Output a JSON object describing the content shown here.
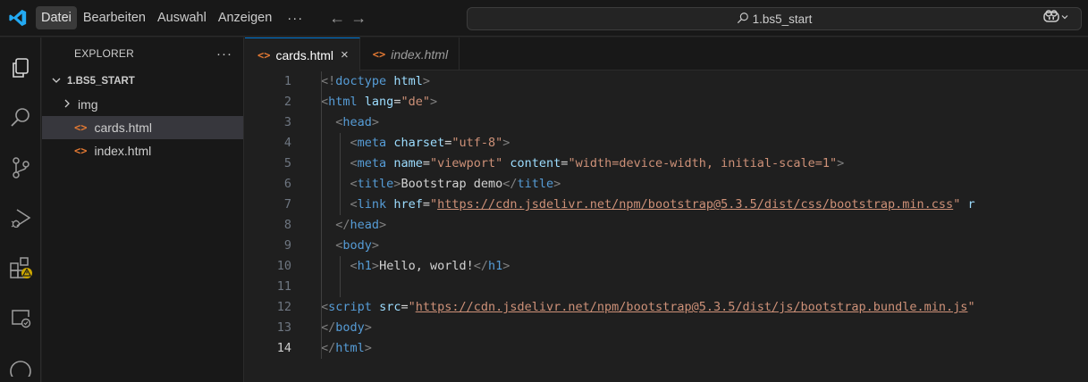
{
  "menu": {
    "items": [
      "Datei",
      "Bearbeiten",
      "Auswahl",
      "Anzeigen"
    ],
    "more": "···"
  },
  "nav": {
    "back": "←",
    "forward": "→"
  },
  "search": {
    "text": "1.bs5_start"
  },
  "sidebar": {
    "title": "EXPLORER",
    "more": "···",
    "root": "1.BS5_START",
    "items": [
      {
        "label": "img",
        "kind": "folder"
      },
      {
        "label": "cards.html",
        "kind": "file",
        "selected": true
      },
      {
        "label": "index.html",
        "kind": "file"
      }
    ]
  },
  "tabs": [
    {
      "label": "cards.html",
      "active": true
    },
    {
      "label": "index.html",
      "active": false,
      "preview": true
    }
  ],
  "tab_icon": "<>",
  "tab_close": "×",
  "code": {
    "current_line": 14,
    "lines": [
      [
        [
          "p",
          "<!"
        ],
        [
          "t",
          "doctype"
        ],
        [
          "x",
          " "
        ],
        [
          "a",
          "html"
        ],
        [
          "p",
          ">"
        ]
      ],
      [
        [
          "p",
          "<"
        ],
        [
          "t",
          "html"
        ],
        [
          "x",
          " "
        ],
        [
          "a",
          "lang"
        ],
        [
          "x",
          "="
        ],
        [
          "s",
          "\"de\""
        ],
        [
          "p",
          ">"
        ]
      ],
      [
        [
          "x",
          "  "
        ],
        [
          "p",
          "<"
        ],
        [
          "t",
          "head"
        ],
        [
          "p",
          ">"
        ]
      ],
      [
        [
          "x",
          "    "
        ],
        [
          "p",
          "<"
        ],
        [
          "t",
          "meta"
        ],
        [
          "x",
          " "
        ],
        [
          "a",
          "charset"
        ],
        [
          "x",
          "="
        ],
        [
          "s",
          "\"utf-8\""
        ],
        [
          "p",
          ">"
        ]
      ],
      [
        [
          "x",
          "    "
        ],
        [
          "p",
          "<"
        ],
        [
          "t",
          "meta"
        ],
        [
          "x",
          " "
        ],
        [
          "a",
          "name"
        ],
        [
          "x",
          "="
        ],
        [
          "s",
          "\"viewport\""
        ],
        [
          "x",
          " "
        ],
        [
          "a",
          "content"
        ],
        [
          "x",
          "="
        ],
        [
          "s",
          "\"width=device-width, initial-scale=1\""
        ],
        [
          "p",
          ">"
        ]
      ],
      [
        [
          "x",
          "    "
        ],
        [
          "p",
          "<"
        ],
        [
          "t",
          "title"
        ],
        [
          "p",
          ">"
        ],
        [
          "x",
          "Bootstrap demo"
        ],
        [
          "p",
          "</"
        ],
        [
          "t",
          "title"
        ],
        [
          "p",
          ">"
        ]
      ],
      [
        [
          "x",
          "    "
        ],
        [
          "p",
          "<"
        ],
        [
          "t",
          "link"
        ],
        [
          "x",
          " "
        ],
        [
          "a",
          "href"
        ],
        [
          "x",
          "="
        ],
        [
          "s",
          "\""
        ],
        [
          "u",
          "https://cdn.jsdelivr.net/npm/bootstrap@5.3.5/dist/css/bootstrap.min.css"
        ],
        [
          "s",
          "\""
        ],
        [
          "x",
          " "
        ],
        [
          "a",
          "r"
        ]
      ],
      [
        [
          "x",
          "  "
        ],
        [
          "p",
          "</"
        ],
        [
          "t",
          "head"
        ],
        [
          "p",
          ">"
        ]
      ],
      [
        [
          "x",
          "  "
        ],
        [
          "p",
          "<"
        ],
        [
          "t",
          "body"
        ],
        [
          "p",
          ">"
        ]
      ],
      [
        [
          "x",
          "    "
        ],
        [
          "p",
          "<"
        ],
        [
          "t",
          "h1"
        ],
        [
          "p",
          ">"
        ],
        [
          "x",
          "Hello, world!"
        ],
        [
          "p",
          "</"
        ],
        [
          "t",
          "h1"
        ],
        [
          "p",
          ">"
        ]
      ],
      [],
      [
        [
          "p",
          "<"
        ],
        [
          "t",
          "script"
        ],
        [
          "x",
          " "
        ],
        [
          "a",
          "src"
        ],
        [
          "x",
          "="
        ],
        [
          "s",
          "\""
        ],
        [
          "u",
          "https://cdn.jsdelivr.net/npm/bootstrap@5.3.5/dist/js/bootstrap.bundle.min.js"
        ],
        [
          "s",
          "\""
        ]
      ],
      [
        [
          "p",
          "</"
        ],
        [
          "t",
          "body"
        ],
        [
          "p",
          ">"
        ]
      ],
      [
        [
          "p",
          "</"
        ],
        [
          "t",
          "html"
        ],
        [
          "p",
          ">"
        ]
      ]
    ]
  },
  "colors": {
    "accent": "#0078d4",
    "html_icon": "#e37933",
    "tag": "#569cd6",
    "attribute": "#9cdcfe",
    "string": "#ce9178",
    "warning_badge": "#cca700"
  },
  "icons": {
    "app": "vscode-logo-icon",
    "activity": [
      "explorer-icon",
      "search-icon",
      "source-control-icon",
      "run-debug-icon",
      "extensions-icon",
      "remote-explorer-icon",
      "accounts-icon"
    ],
    "search": "search-icon",
    "copilot": "copilot-icon"
  }
}
